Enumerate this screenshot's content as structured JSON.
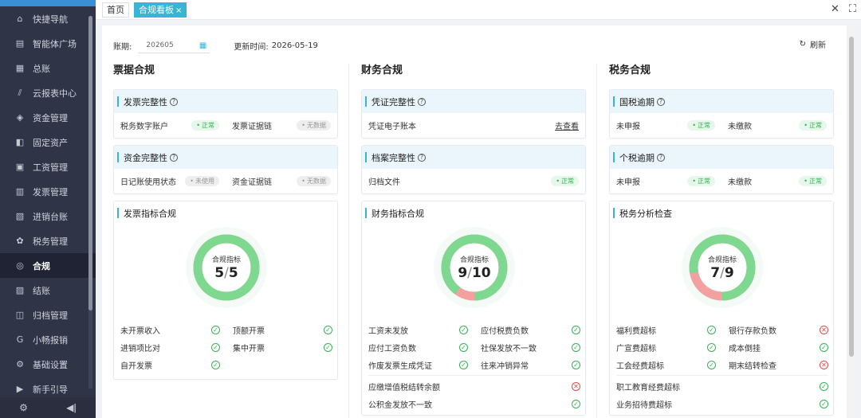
{
  "sidebar": {
    "items": [
      {
        "label": "快捷导航",
        "icon": "home-icon",
        "glyph": "⌂"
      },
      {
        "label": "智能体广场",
        "icon": "clipboard-icon",
        "glyph": "▤"
      },
      {
        "label": "总账",
        "icon": "ledger-icon",
        "glyph": "▦"
      },
      {
        "label": "云报表中心",
        "icon": "chart-icon",
        "glyph": "⫽"
      },
      {
        "label": "资金管理",
        "icon": "money-icon",
        "glyph": "◈"
      },
      {
        "label": "固定资产",
        "icon": "asset-icon",
        "glyph": "◧"
      },
      {
        "label": "工资管理",
        "icon": "salary-icon",
        "glyph": "▣"
      },
      {
        "label": "发票管理",
        "icon": "invoice-icon",
        "glyph": "▥"
      },
      {
        "label": "进销台账",
        "icon": "stock-icon",
        "glyph": "▧"
      },
      {
        "label": "税务管理",
        "icon": "tax-icon",
        "glyph": "✿"
      },
      {
        "label": "合规",
        "icon": "shield-icon",
        "glyph": "◎"
      },
      {
        "label": "结账",
        "icon": "close-book-icon",
        "glyph": "▨"
      },
      {
        "label": "归档管理",
        "icon": "archive-icon",
        "glyph": "◫"
      },
      {
        "label": "小畅报销",
        "icon": "reimburse-icon",
        "glyph": "G"
      },
      {
        "label": "基础设置",
        "icon": "settings-icon",
        "glyph": "⚙"
      },
      {
        "label": "新手引导",
        "icon": "guide-icon",
        "glyph": "▶"
      }
    ],
    "active_index": 10
  },
  "tabs": [
    {
      "label": "首页"
    },
    {
      "label": "合规看板"
    }
  ],
  "filter": {
    "period_label": "账期:",
    "period_value": "202605",
    "update_label": "更新时间:",
    "update_value": "2026-05-19",
    "refresh_label": "刷新"
  },
  "columns": {
    "invoice": {
      "title": "票据合规",
      "card1": {
        "title": "发票完整性",
        "items": [
          {
            "label": "税务数字账户",
            "status": "正常"
          },
          {
            "label": "发票证据链",
            "status": "无数据"
          }
        ]
      },
      "card2": {
        "title": "资金完整性",
        "items": [
          {
            "label": "日记账使用状态",
            "status": "未使用"
          },
          {
            "label": "资金证据链",
            "status": "无数据"
          }
        ]
      },
      "card3": {
        "title": "发票指标合规",
        "center_label": "合规指标",
        "passed": 5,
        "total": 5,
        "checks": [
          {
            "label": "未开票收入",
            "ok": true
          },
          {
            "label": "顶额开票",
            "ok": true
          },
          {
            "label": "进销项比对",
            "ok": true
          },
          {
            "label": "集中开票",
            "ok": true
          },
          {
            "label": "自开发票",
            "ok": true
          }
        ]
      }
    },
    "finance": {
      "title": "财务合规",
      "card1": {
        "title": "凭证完整性",
        "item": "凭证电子账本",
        "link": "去查看"
      },
      "card2": {
        "title": "档案完整性",
        "item": "归档文件",
        "status": "正常"
      },
      "card3": {
        "title": "财务指标合规",
        "center_label": "合规指标",
        "passed": 9,
        "total": 10,
        "checks": [
          {
            "label": "工资未发放",
            "ok": true
          },
          {
            "label": "应付税费负数",
            "ok": true
          },
          {
            "label": "应付工资负数",
            "ok": true
          },
          {
            "label": "社保发放不一致",
            "ok": true
          },
          {
            "label": "作废发票生成凭证",
            "ok": true
          },
          {
            "label": "往来冲销异常",
            "ok": true
          }
        ],
        "full_checks": [
          {
            "label": "应缴增值税结转余额",
            "ok": false
          },
          {
            "label": "公积金发放不一致",
            "ok": true
          }
        ]
      }
    },
    "tax": {
      "title": "税务合规",
      "card1": {
        "title": "国税逾期",
        "items": [
          {
            "label": "未申报",
            "status": "正常"
          },
          {
            "label": "未缴款",
            "status": "正常"
          }
        ]
      },
      "card2": {
        "title": "个税逾期",
        "items": [
          {
            "label": "未申报",
            "status": "正常"
          },
          {
            "label": "未缴款",
            "status": "正常"
          }
        ]
      },
      "card3": {
        "title": "税务分析检查",
        "center_label": "合规指标",
        "passed": 7,
        "total": 9,
        "checks": [
          {
            "label": "福利费超标",
            "ok": true
          },
          {
            "label": "银行存款负数",
            "ok": false
          },
          {
            "label": "广宣费超标",
            "ok": true
          },
          {
            "label": "成本倒挂",
            "ok": true
          },
          {
            "label": "工会经费超标",
            "ok": true
          },
          {
            "label": "期末结转检查",
            "ok": false
          }
        ],
        "full_checks": [
          {
            "label": "职工教育经费超标",
            "ok": true
          },
          {
            "label": "业务招待费超标",
            "ok": true
          }
        ]
      }
    }
  },
  "colors": {
    "ok": "#7ed88f",
    "bad": "#f2a0a0",
    "accent": "#39b5d4",
    "sidebar": "#2f3447"
  }
}
